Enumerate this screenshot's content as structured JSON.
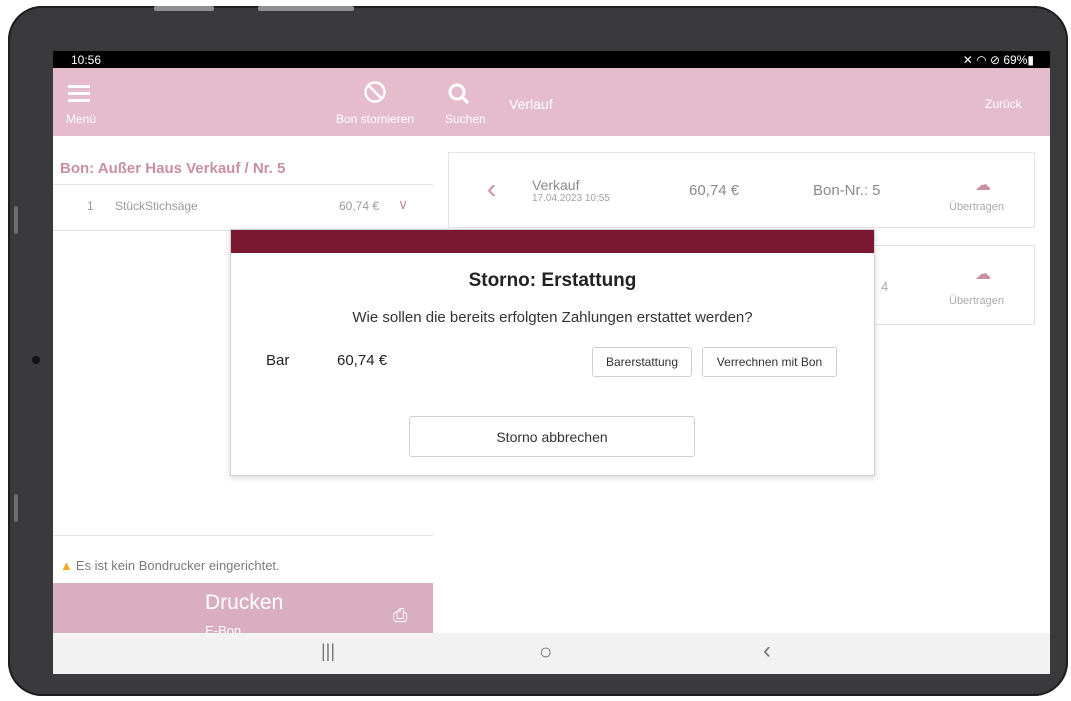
{
  "status_bar": {
    "time": "10:56",
    "indicators": "✕ ◠ ⊘ 69%▮"
  },
  "left_toolbar": {
    "menu_label": "Menü",
    "menu_icon": "hamburger-icon",
    "cancel_label": "Bon stornieren",
    "cancel_icon": "no-sign-icon"
  },
  "right_toolbar": {
    "search_label": "Suchen",
    "search_icon": "search-icon",
    "title": "Verlauf",
    "back_label": "Zurück"
  },
  "order": {
    "title": "Bon: Außer Haus Verkauf / Nr. 5",
    "items": [
      {
        "qty": "1",
        "name": "StückStichsäge",
        "price": "60,74 €"
      }
    ]
  },
  "warning": "Es ist kein Bondrucker eingerichtet.",
  "print_button": {
    "label": "Drucken",
    "sub_label": "E-Bon",
    "icon": "printer-qr-icon"
  },
  "history": [
    {
      "type": "Verkauf",
      "datetime": "17.04.2023 10:55",
      "amount": "60,74 €",
      "bon_nr": "Bon-Nr.: 5",
      "upload_label": "Übertragen"
    },
    {
      "bon_nr_partial": "4",
      "upload_label": "Übertragen"
    }
  ],
  "dialog": {
    "title": "Storno: Erstattung",
    "message": "Wie sollen die bereits erfolgten Zahlungen erstattet werden?",
    "payment_method": "Bar",
    "payment_amount": "60,74 €",
    "cash_refund_label": "Barerstattung",
    "offset_label": "Verrechnen mit Bon",
    "abort_label": "Storno abbrechen"
  },
  "nav_bar": {
    "recents": "|||",
    "home": "○",
    "back": "‹"
  },
  "colors": {
    "brand_pink": "#e5bccb",
    "accent_text": "#c98fa3",
    "dialog_bar": "#7a1731",
    "print_bg": "#d9aebe"
  }
}
